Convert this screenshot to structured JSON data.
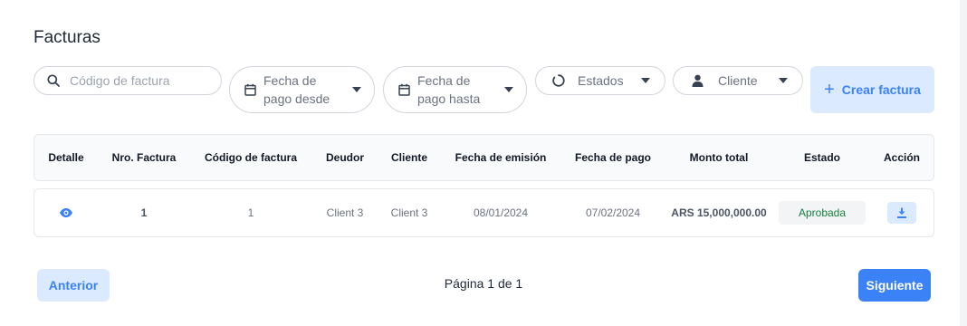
{
  "page": {
    "title": "Facturas"
  },
  "filters": {
    "search_placeholder": "Código de factura",
    "fecha_desde": "Fecha de pago desde",
    "fecha_hasta": "Fecha de pago hasta",
    "estados": "Estados",
    "cliente": "Cliente"
  },
  "actions": {
    "create_invoice": "Crear factura"
  },
  "table": {
    "columns": [
      "Detalle",
      "Nro. Factura",
      "Código de factura",
      "Deudor",
      "Cliente",
      "Fecha de emisión",
      "Fecha de pago",
      "Monto total",
      "Estado",
      "Acción"
    ],
    "rows": [
      {
        "nro": "1",
        "codigo": "1",
        "deudor": "Client 3",
        "cliente": "Client 3",
        "fecha_emision": "08/01/2024",
        "fecha_pago": "07/02/2024",
        "monto": "ARS 15,000,000.00",
        "estado": "Aprobada"
      }
    ]
  },
  "pagination": {
    "prev_label": "Anterior",
    "page_info": "Página 1 de 1",
    "next_label": "Siguiente"
  },
  "colors": {
    "accent": "#3b82f6",
    "accent_light": "#dbeafe",
    "status_approved": "#15803d"
  },
  "icons": {
    "search": "search-icon",
    "calendar": "calendar-icon",
    "caret": "caret-down-icon",
    "status": "circle-spinner-icon",
    "user": "user-icon",
    "plus": "plus-icon",
    "view": "eye-icon",
    "download": "download-icon"
  }
}
